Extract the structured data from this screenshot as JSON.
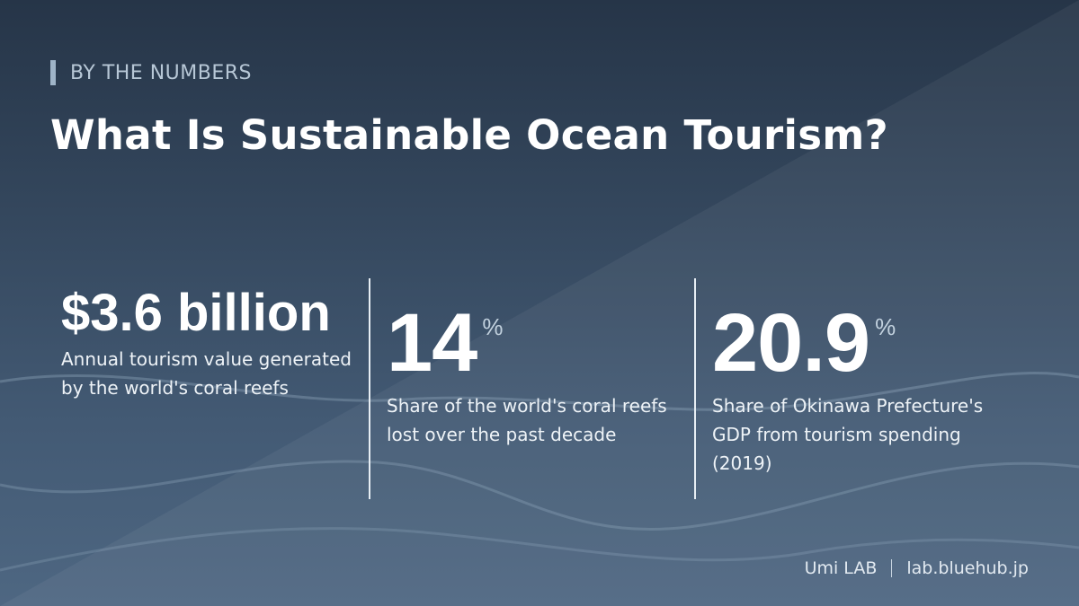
{
  "eyebrow": "BY THE NUMBERS",
  "headline": "What Is Sustainable Ocean Tourism?",
  "stats": [
    {
      "value": "$3.6 billion",
      "unit": "",
      "description": "Annual tourism value generated by the world's coral reefs"
    },
    {
      "value": "14",
      "unit": "%",
      "description": "Share of the world's coral reefs lost over the past decade"
    },
    {
      "value": "20.9",
      "unit": "%",
      "description": "Share of Okinawa Prefecture's GDP from tourism spending (2019)"
    }
  ],
  "footer": {
    "brand": "Umi LAB",
    "site": "lab.bluehub.jp"
  },
  "colors": {
    "background_top": "#263548",
    "background_bottom": "#4e6782",
    "accent": "#9fb4c8",
    "text": "#ffffff"
  }
}
